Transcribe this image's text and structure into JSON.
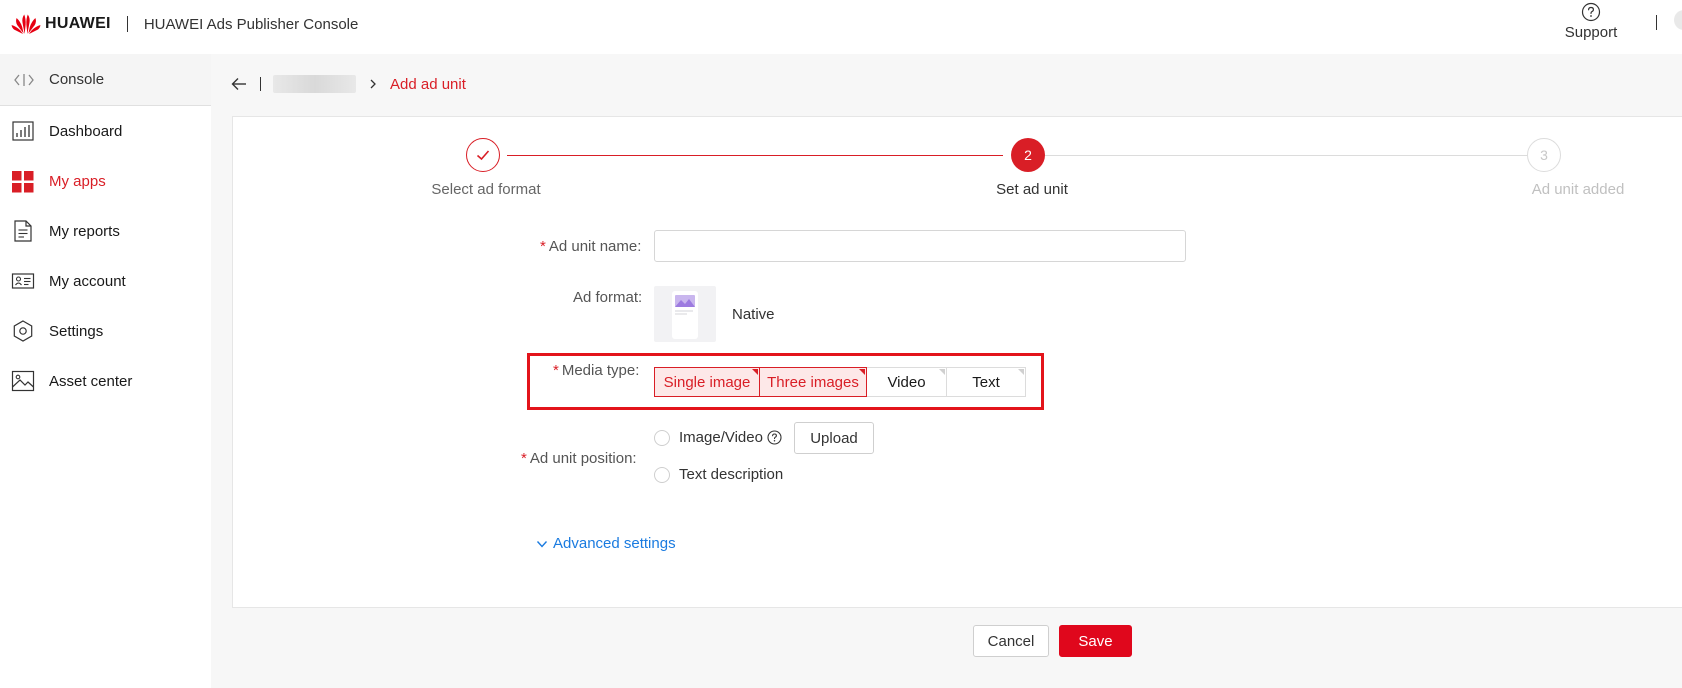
{
  "header": {
    "brand": "HUAWEI",
    "product": "HUAWEI Ads Publisher Console",
    "support_label": "Support"
  },
  "sidebar": {
    "title": "Console",
    "items": [
      {
        "label": "Dashboard",
        "icon": "bar-chart-icon"
      },
      {
        "label": "My apps",
        "icon": "grid-icon"
      },
      {
        "label": "My reports",
        "icon": "document-icon"
      },
      {
        "label": "My account",
        "icon": "id-card-icon"
      },
      {
        "label": "Settings",
        "icon": "hexagon-gear-icon"
      },
      {
        "label": "Asset center",
        "icon": "image-icon"
      }
    ],
    "active_item": "My apps"
  },
  "breadcrumb": {
    "current": "Add ad unit"
  },
  "steps": [
    {
      "number": "",
      "label": "Select ad format",
      "status": "done"
    },
    {
      "number": "2",
      "label": "Set ad unit",
      "status": "current"
    },
    {
      "number": "3",
      "label": "Ad unit added",
      "status": "todo"
    }
  ],
  "form": {
    "name_label": "Ad unit name:",
    "name_value": "",
    "format_label": "Ad format:",
    "format_value": "Native",
    "media_label": "Media type:",
    "media_options": [
      {
        "label": "Single image",
        "selected": true
      },
      {
        "label": "Three images",
        "selected": true
      },
      {
        "label": "Video",
        "selected": false
      },
      {
        "label": "Text",
        "selected": false
      }
    ],
    "position_label": "Ad unit position:",
    "position_options": [
      {
        "label": "Image/Video",
        "selected": false
      },
      {
        "label": "Text description",
        "selected": false
      }
    ],
    "upload_label": "Upload",
    "advanced_label": "Advanced settings"
  },
  "actions": {
    "cancel_label": "Cancel",
    "save_label": "Save"
  },
  "colors": {
    "accent": "#d91e26",
    "save_button": "#e0071c",
    "link": "#1a7be0",
    "highlight_box": "#e3141b"
  }
}
